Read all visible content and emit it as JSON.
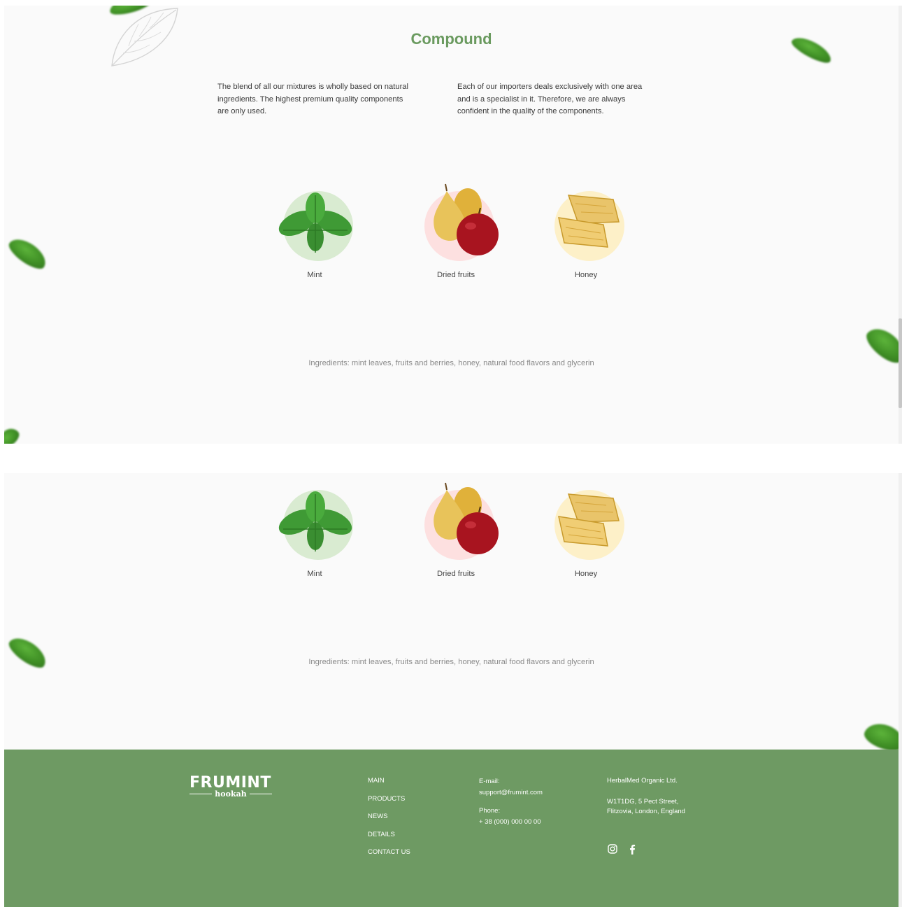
{
  "compound": {
    "title": "Compound",
    "intro_left": "The blend of all our mixtures is wholly based on natural ingredients. The highest premium quality components are only used.",
    "intro_right": "Each of our importers deals exclusively with one area and is a specialist in it. Therefore, we are always confident in the quality of the components."
  },
  "ingredients": [
    {
      "label": "Mint",
      "icon": "mint-icon",
      "circle_color": "#d9ebd1"
    },
    {
      "label": "Dried fruits",
      "icon": "dried-fruits-icon",
      "circle_color": "#fde0e0"
    },
    {
      "label": "Honey",
      "icon": "honey-icon",
      "circle_color": "#fdf0c8"
    }
  ],
  "ingredients_line": "Ingredients: mint leaves, fruits and berries, honey, natural food flavors and glycerin",
  "footer": {
    "logo_main": "FRUMINT",
    "logo_sub": "hookah",
    "nav": [
      "MAIN",
      "PRODUCTS",
      "NEWS",
      "DETAILS",
      "CONTACT US"
    ],
    "email_label": "E-mail:",
    "email_value": "support@frumint.com",
    "phone_label": "Phone:",
    "phone_value": "+ 38 (000) 000 00 00",
    "company": "HerbalMed Organic Ltd.",
    "address_line1": "W1T1DG, 5 Pect Street,",
    "address_line2": "Flitzovia, London, England",
    "social": [
      "instagram-icon",
      "facebook-icon"
    ]
  },
  "colors": {
    "brand_green": "#6e9a63",
    "title_green": "#6a9a5f",
    "panel_bg": "#fafafa"
  }
}
